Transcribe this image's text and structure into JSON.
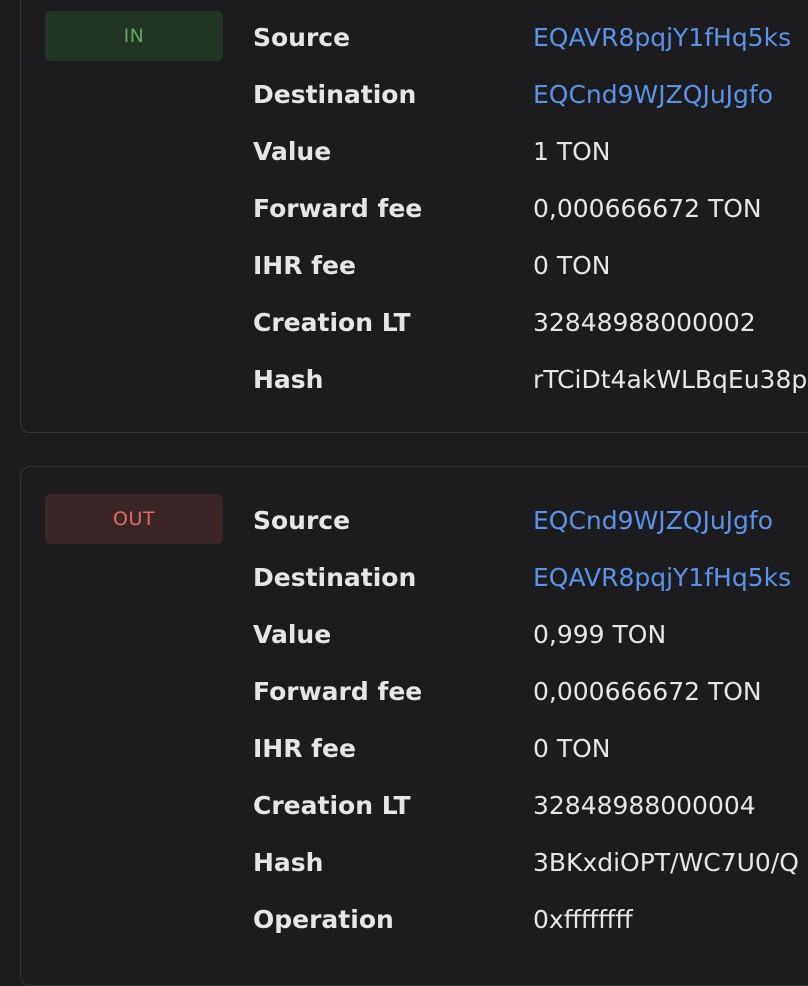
{
  "messages": [
    {
      "direction_label": "IN",
      "fields": [
        {
          "label": "Source",
          "value": "EQAVR8pqjY1fHq5ks",
          "link": true
        },
        {
          "label": "Destination",
          "value": "EQCnd9WJZQJuJgfo",
          "link": true
        },
        {
          "label": "Value",
          "value": "1 TON",
          "link": false
        },
        {
          "label": "Forward fee",
          "value": "0,000666672 TON",
          "link": false
        },
        {
          "label": "IHR fee",
          "value": "0 TON",
          "link": false
        },
        {
          "label": "Creation LT",
          "value": "32848988000002",
          "link": false
        },
        {
          "label": "Hash",
          "value": "rTCiDt4akWLBqEu38p",
          "link": false
        }
      ]
    },
    {
      "direction_label": "OUT",
      "fields": [
        {
          "label": "Source",
          "value": "EQCnd9WJZQJuJgfo",
          "link": true
        },
        {
          "label": "Destination",
          "value": "EQAVR8pqjY1fHq5ks",
          "link": true
        },
        {
          "label": "Value",
          "value": "0,999 TON",
          "link": false
        },
        {
          "label": "Forward fee",
          "value": "0,000666672 TON",
          "link": false
        },
        {
          "label": "IHR fee",
          "value": "0 TON",
          "link": false
        },
        {
          "label": "Creation LT",
          "value": "32848988000004",
          "link": false
        },
        {
          "label": "Hash",
          "value": "3BKxdiOPT/WC7U0/Q",
          "link": false
        },
        {
          "label": "Operation",
          "value": "0xffffffff",
          "link": false
        }
      ]
    }
  ],
  "colors": {
    "background": "#1c1c1e",
    "link": "#5b93e8",
    "in_badge_bg": "#223525",
    "in_badge_text": "#5fa85b",
    "out_badge_bg": "#3b2527",
    "out_badge_text": "#e26b64"
  }
}
